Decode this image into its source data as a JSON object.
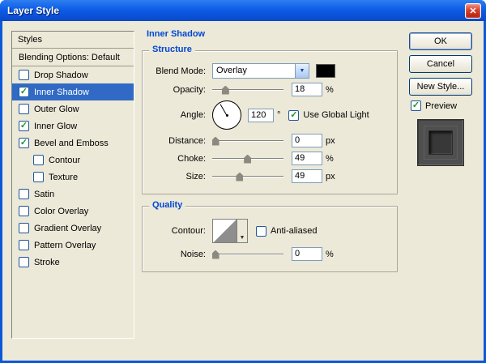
{
  "window": {
    "title": "Layer Style"
  },
  "icons": {
    "close": "✕",
    "check": "✓",
    "combo_arrow": "▼",
    "contour_arrow": "▼"
  },
  "colors": {
    "accent": "#0046D5",
    "selection": "#316AC5",
    "check": "#1A9428",
    "frame": "#0C59D8",
    "titlebar_top": "#2E7EF0",
    "titlebar_mid": "#0D5DE8",
    "titlebar_bottom": "#0948C8",
    "close_red": "#D8402A",
    "swatch_color": "#000000"
  },
  "sidebar": {
    "header": "Styles",
    "items": [
      {
        "label": "Blending Options: Default",
        "type": "plain"
      },
      {
        "label": "Drop Shadow",
        "checked": false
      },
      {
        "label": "Inner Shadow",
        "checked": true,
        "selected": true
      },
      {
        "label": "Outer Glow",
        "checked": false
      },
      {
        "label": "Inner Glow",
        "checked": true
      },
      {
        "label": "Bevel and Emboss",
        "checked": true
      },
      {
        "label": "Contour",
        "checked": false,
        "indent": true
      },
      {
        "label": "Texture",
        "checked": false,
        "indent": true
      },
      {
        "label": "Satin",
        "checked": false
      },
      {
        "label": "Color Overlay",
        "checked": false
      },
      {
        "label": "Gradient Overlay",
        "checked": false
      },
      {
        "label": "Pattern Overlay",
        "checked": false
      },
      {
        "label": "Stroke",
        "checked": false
      }
    ]
  },
  "main": {
    "title": "Inner Shadow",
    "structure": {
      "title": "Structure",
      "blend_mode": {
        "label": "Blend Mode:",
        "value": "Overlay"
      },
      "opacity": {
        "label": "Opacity:",
        "value": "18",
        "unit": "%",
        "pos": 18
      },
      "angle": {
        "label": "Angle:",
        "value": "120",
        "unit": "°",
        "use_global_light": "Use Global Light",
        "use_global_light_checked": true
      },
      "distance": {
        "label": "Distance:",
        "value": "0",
        "unit": "px",
        "pos": 4
      },
      "choke": {
        "label": "Choke:",
        "value": "49",
        "unit": "%",
        "pos": 49
      },
      "size": {
        "label": "Size:",
        "value": "49",
        "unit": "px",
        "pos": 38
      }
    },
    "quality": {
      "title": "Quality",
      "contour": {
        "label": "Contour:"
      },
      "anti_aliased": {
        "label": "Anti-aliased",
        "checked": false
      },
      "noise": {
        "label": "Noise:",
        "value": "0",
        "unit": "%",
        "pos": 4
      }
    }
  },
  "actions": {
    "ok": "OK",
    "cancel": "Cancel",
    "new_style": "New Style...",
    "preview": {
      "label": "Preview",
      "checked": true
    }
  }
}
